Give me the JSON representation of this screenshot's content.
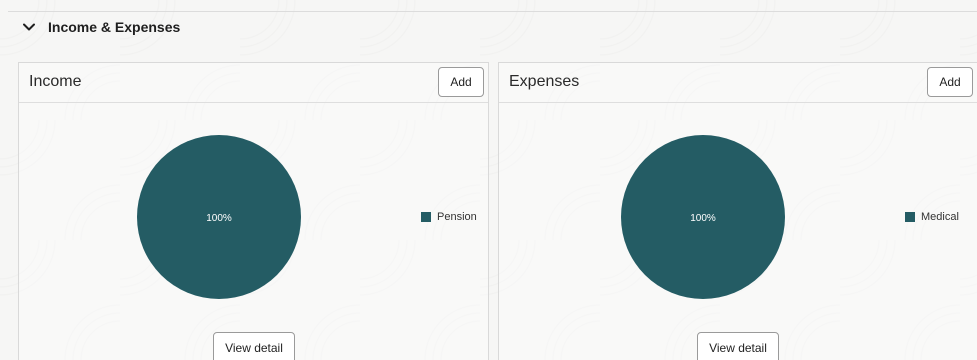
{
  "section": {
    "title": "Income & Expenses",
    "collapse_icon": "chevron-down-icon"
  },
  "income": {
    "title": "Income",
    "add_label": "Add",
    "view_detail_label": "View detail",
    "chart_data": {
      "type": "pie",
      "slices": [
        {
          "label": "Pension",
          "value": 100,
          "display": "100%",
          "color": "#245c64"
        }
      ]
    }
  },
  "expenses": {
    "title": "Expenses",
    "add_label": "Add",
    "view_detail_label": "View detail",
    "chart_data": {
      "type": "pie",
      "slices": [
        {
          "label": "Medical",
          "value": 100,
          "display": "100%",
          "color": "#245c64"
        }
      ]
    }
  },
  "colors": {
    "pie_fill": "#245c64",
    "border": "#d9d9d9",
    "background": "#f6f6f5"
  }
}
